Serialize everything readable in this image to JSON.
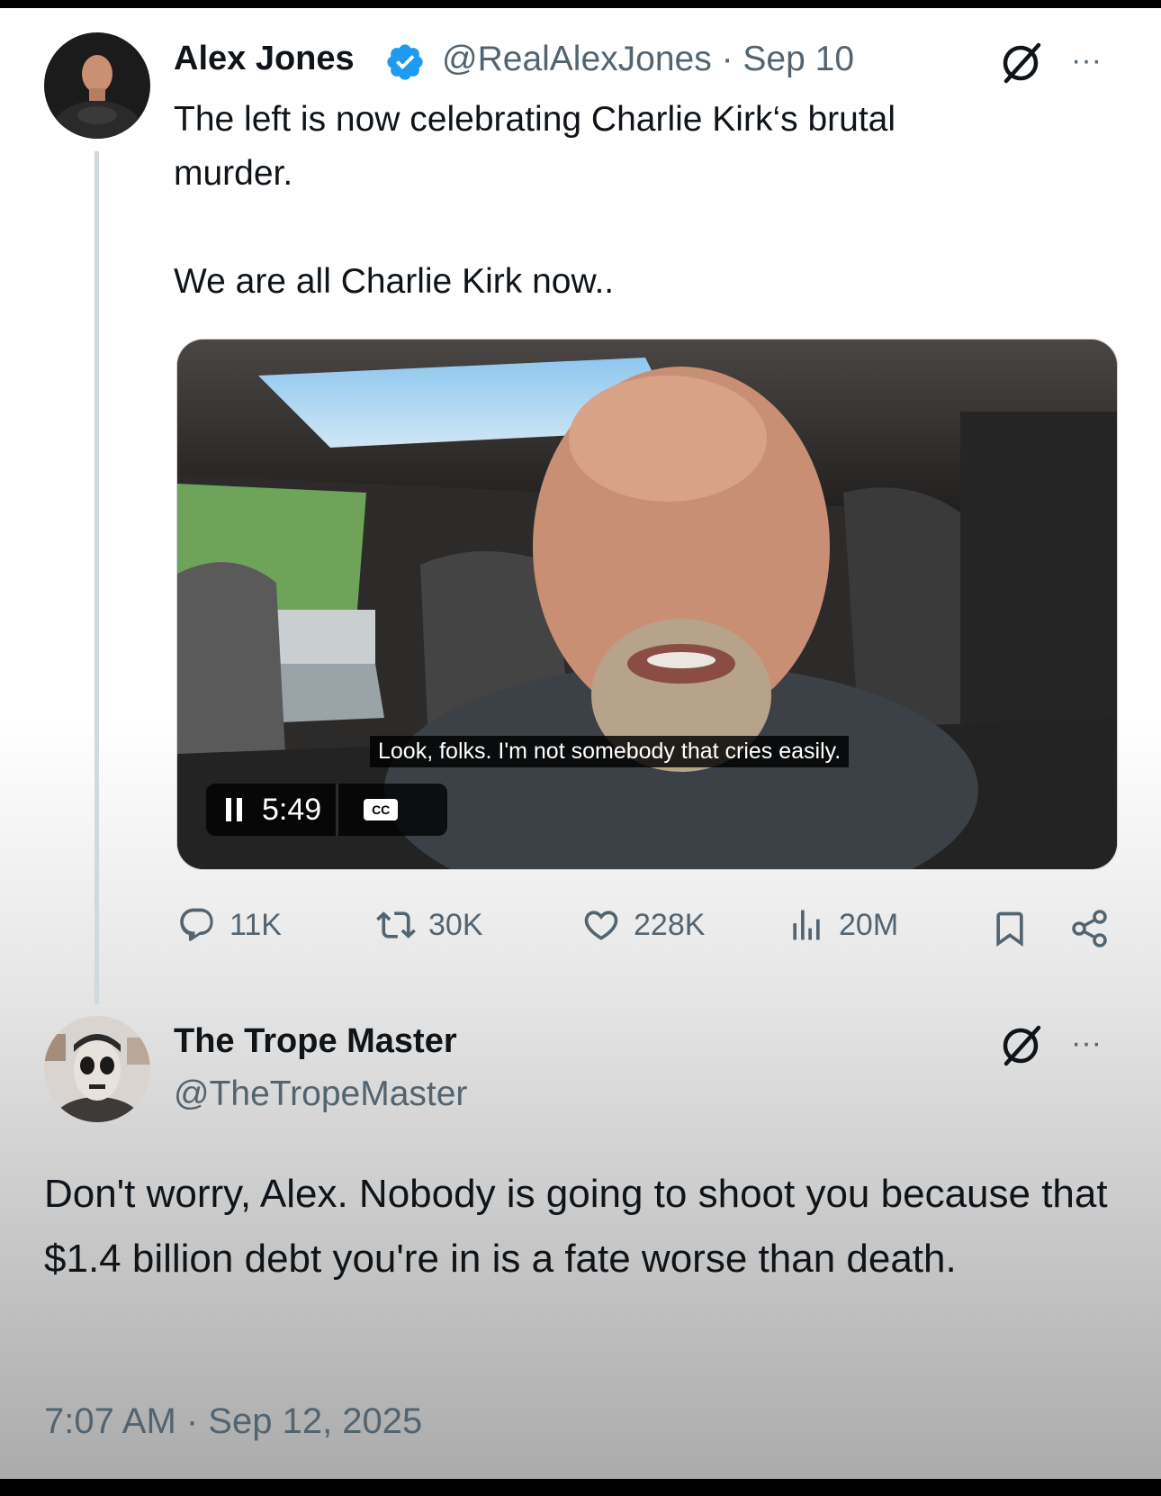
{
  "tweet": {
    "author_name": "Alex Jones",
    "handle_date": "@RealAlexJones · Sep 10",
    "text_line1": "The left is now celebrating Charlie Kirk‘s brutal",
    "text_line2": "murder.",
    "text_line3": "We are all Charlie Kirk now..",
    "video": {
      "caption": "Look, folks. I'm not somebody that cries easily.",
      "time": "5:49",
      "cc_label": "CC"
    },
    "actions": {
      "replies": "11K",
      "reposts": "30K",
      "likes": "228K",
      "views": "20M"
    }
  },
  "reply": {
    "author_name": "The Trope Master",
    "handle": "@TheTropeMaster",
    "text": "Don't worry, Alex.  Nobody is going to shoot you because that $1.4 billion debt you're in is a fate worse than death.",
    "timestamp": "7:07 AM · Sep 12, 2025"
  },
  "icons": {
    "verified_color": "#1d9bf0",
    "more": "···"
  }
}
